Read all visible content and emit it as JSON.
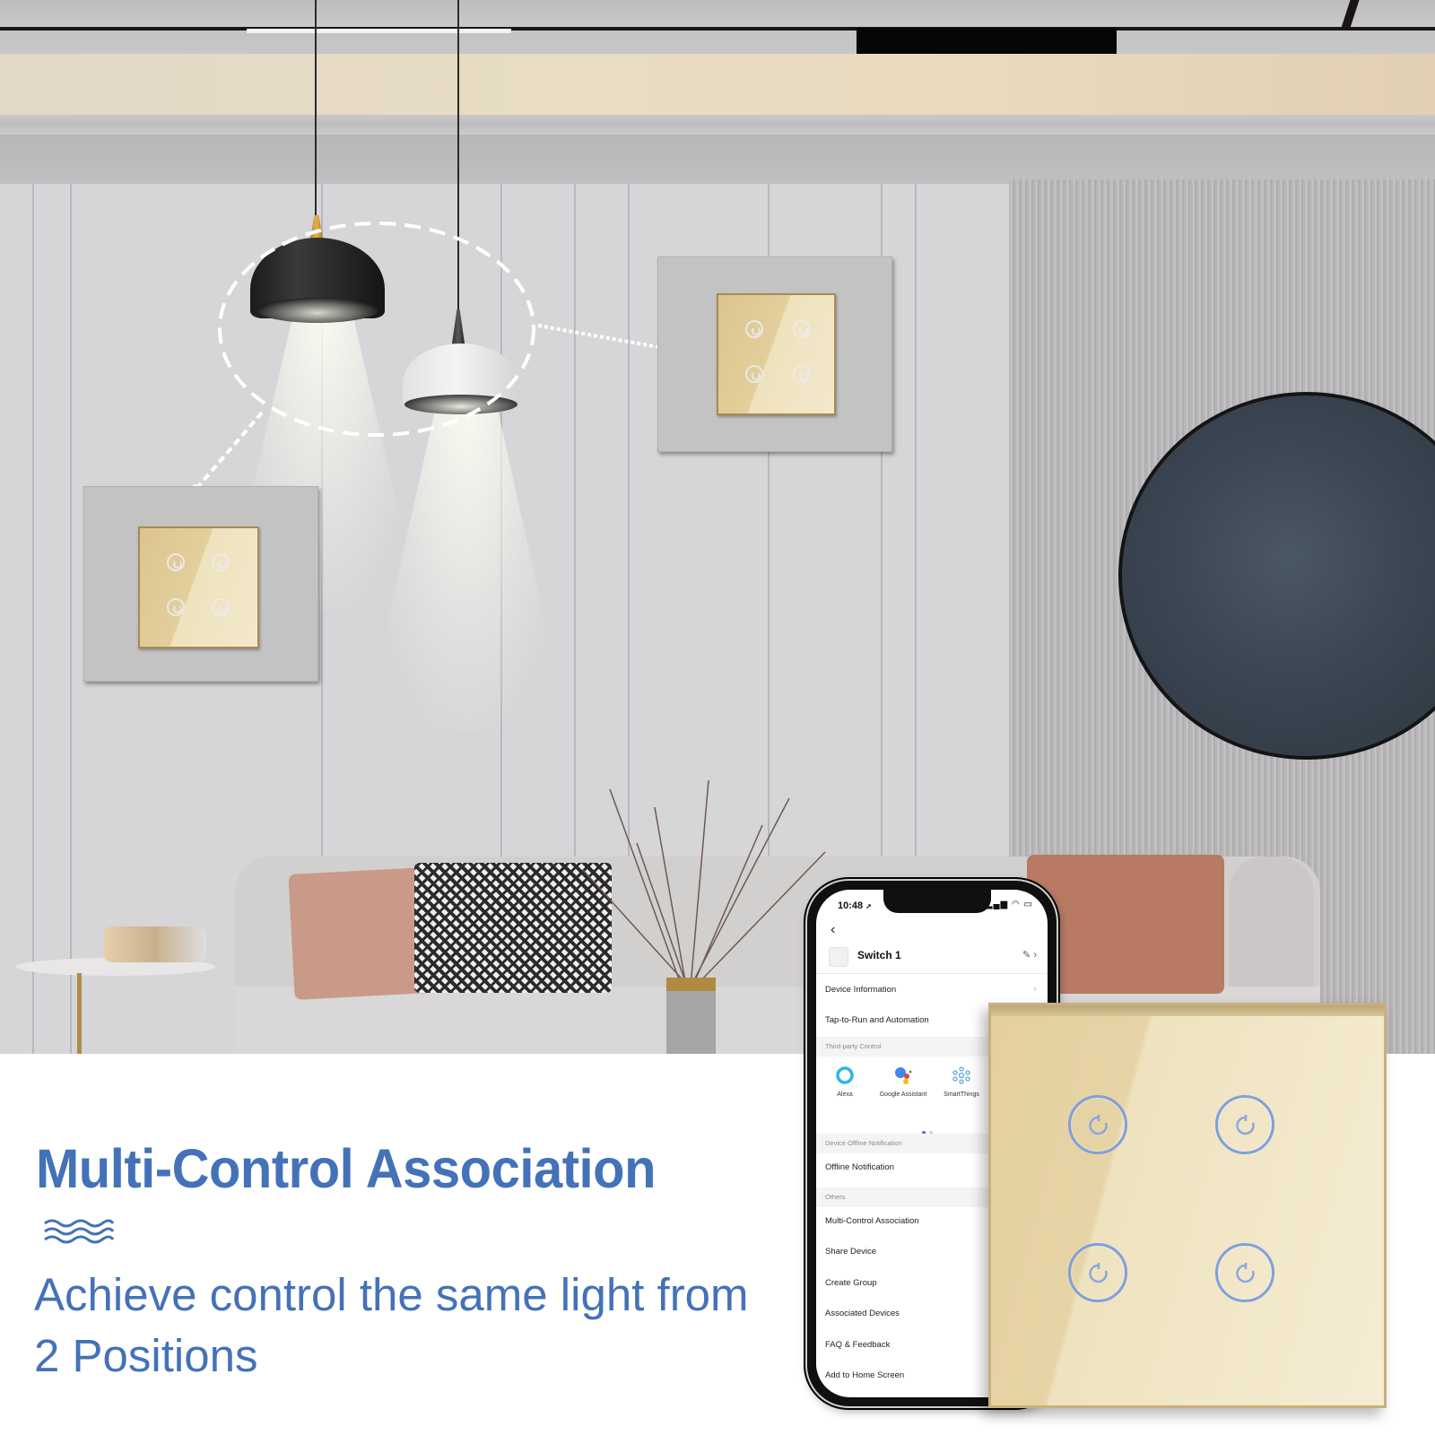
{
  "marketing": {
    "headline": "Multi-Control Association",
    "decorative_icon": "wave-lines-icon",
    "subtext_line1": "Achieve control the same light from",
    "subtext_line2": "2 Positions",
    "accent_color": "#4472b8"
  },
  "scene": {
    "lamps": [
      "black-pendant-lamp",
      "white-pendant-lamp"
    ],
    "association_ring": "dashed-circle",
    "wall_switches": [
      {
        "id": "left-wall-switch",
        "gang_count": 4
      },
      {
        "id": "right-wall-switch",
        "gang_count": 4
      }
    ],
    "switch_glass_color": "#e3cf9f"
  },
  "phone": {
    "status_bar": {
      "time": "10:48",
      "location_icon": "location-arrow-icon",
      "signal_icon": "signal-icon",
      "wifi_icon": "wifi-icon",
      "battery_icon": "battery-icon"
    },
    "back_icon": "chevron-left-icon",
    "device": {
      "name": "Switch 1",
      "edit_icon": "pencil-icon",
      "chevron": "›"
    },
    "menu_top": [
      {
        "label": "Device Information"
      },
      {
        "label": "Tap-to-Run and Automation"
      }
    ],
    "sections": {
      "third_party": "Third-party Control",
      "offline": "Device Offline Notification",
      "others": "Others"
    },
    "third_party_items": [
      {
        "label": "Alexa",
        "icon": "alexa-icon"
      },
      {
        "label": "Google Assistant",
        "icon": "google-assistant-icon"
      },
      {
        "label": "SmartThings",
        "icon": "smartthings-icon"
      }
    ],
    "carousel": {
      "page": 1,
      "pages": 2
    },
    "offline_item": {
      "label": "Offline Notification"
    },
    "others_items": [
      {
        "label": "Multi-Control Association"
      },
      {
        "label": "Share Device"
      },
      {
        "label": "Create Group"
      },
      {
        "label": "Associated Devices"
      },
      {
        "label": "FAQ & Feedback"
      },
      {
        "label": "Add to Home Screen"
      }
    ]
  },
  "product": {
    "name": "4-gang glass touch switch",
    "gang_count": 4,
    "glass_color": "#e7d4a6",
    "indicator_color": "#7fa0db"
  }
}
